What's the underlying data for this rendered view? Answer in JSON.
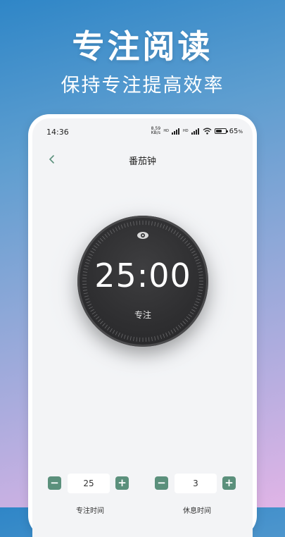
{
  "promo": {
    "title": "专注阅读",
    "subtitle": "保持专注提高效率"
  },
  "status_bar": {
    "time": "14:36",
    "net_speed_value": "8.59",
    "net_speed_unit": "KB/s",
    "hd_label": "HD",
    "battery_percent": "65",
    "battery_unit": "%",
    "battery_level": 0.65
  },
  "nav": {
    "back_icon": "chevron-left-icon",
    "title": "番茄钟"
  },
  "timer": {
    "time": "25:00",
    "mode_label": "专注",
    "mode_icon": "eye-icon"
  },
  "focus_control": {
    "value": "25",
    "label": "专注时间",
    "decrement": "−",
    "increment": "+"
  },
  "rest_control": {
    "value": "3",
    "label": "休息时间",
    "decrement": "−",
    "increment": "+"
  },
  "colors": {
    "accent": "#5b907c",
    "dial": "#2f2f31",
    "background_top": "#2f86c7",
    "background_bottom": "#e0b4e6"
  }
}
